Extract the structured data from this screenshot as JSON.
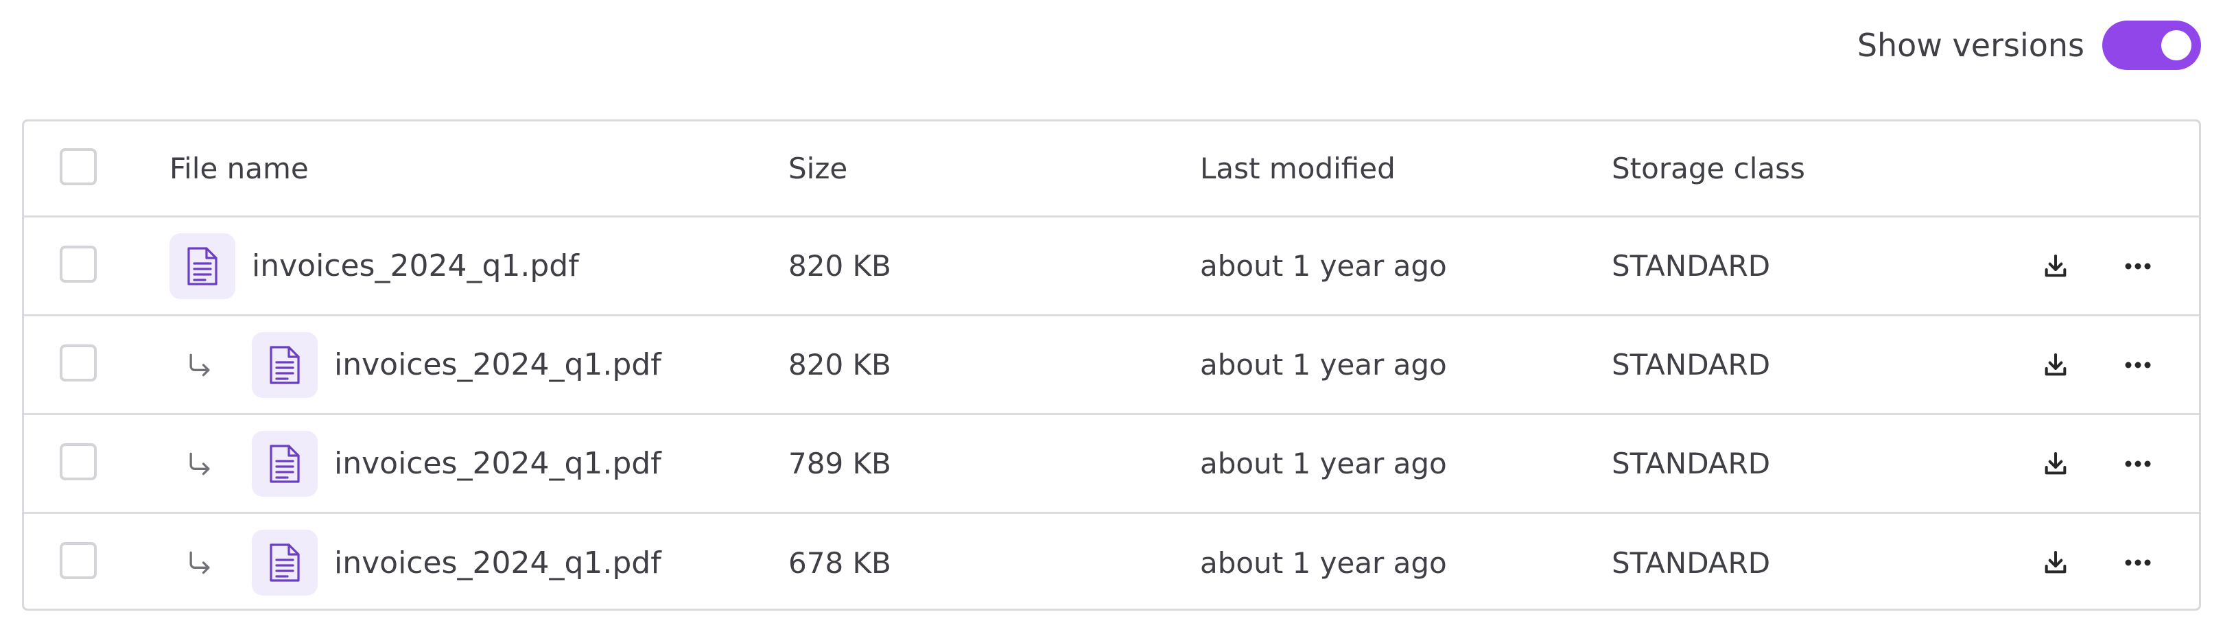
{
  "toolbar": {
    "show_versions_label": "Show versions",
    "show_versions_on": true
  },
  "table": {
    "columns": {
      "name": "File name",
      "size": "Size",
      "modified": "Last modified",
      "storage_class": "Storage class"
    },
    "rows": [
      {
        "name": "invoices_2024_q1.pdf",
        "size": "820 KB",
        "modified": "about 1 year ago",
        "storage_class": "STANDARD",
        "is_version": false
      },
      {
        "name": "invoices_2024_q1.pdf",
        "size": "820 KB",
        "modified": "about 1 year ago",
        "storage_class": "STANDARD",
        "is_version": true
      },
      {
        "name": "invoices_2024_q1.pdf",
        "size": "789 KB",
        "modified": "about 1 year ago",
        "storage_class": "STANDARD",
        "is_version": true
      },
      {
        "name": "invoices_2024_q1.pdf",
        "size": "678 KB",
        "modified": "about 1 year ago",
        "storage_class": "STANDARD",
        "is_version": true
      }
    ]
  },
  "icons": {
    "file": "file-text-icon",
    "version_arrow": "corner-down-right-icon",
    "download": "download-icon",
    "more": "more-horizontal-icon"
  },
  "colors": {
    "accent": "#9146ea",
    "file_icon_bg": "#f1ecfb",
    "file_icon_stroke": "#6b3fc4",
    "border": "#d9d9de",
    "text": "#3f3f46"
  }
}
